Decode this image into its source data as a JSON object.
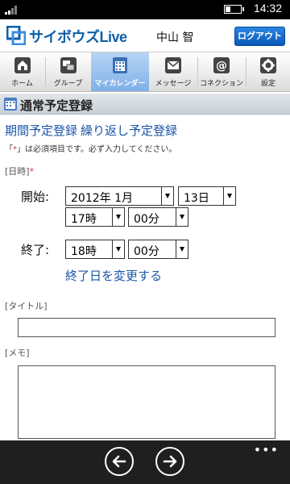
{
  "status_bar": {
    "time": "14:32",
    "battery_icon": "battery-icon",
    "signal_icon": "signal-icon"
  },
  "header": {
    "app_name": "サイボウズLive",
    "user_name": "中山 智",
    "logout_label": "ログアウト"
  },
  "nav": {
    "items": [
      {
        "label": "ホーム",
        "icon": "home-icon",
        "active": false
      },
      {
        "label": "グループ",
        "icon": "group-icon",
        "active": false
      },
      {
        "label": "マイカレンダー",
        "icon": "calendar-icon",
        "active": true
      },
      {
        "label": "メッセージ",
        "icon": "mail-icon",
        "active": false
      },
      {
        "label": "コネクション",
        "icon": "at-icon",
        "active": false
      },
      {
        "label": "設定",
        "icon": "gear-icon",
        "active": false
      }
    ]
  },
  "section": {
    "title": "通常予定登録"
  },
  "links": {
    "period": "期間予定登録",
    "repeat": "繰り返し予定登録"
  },
  "notice": {
    "prefix": "「",
    "star": "*",
    "text": "」は必須項目です。必ず入力してください。"
  },
  "datetime": {
    "label": "[日時]",
    "required_mark": "*",
    "start_label": "開始:",
    "start_month": "2012年 1月",
    "start_day": "13日",
    "start_hour": "17時",
    "start_minute": "00分",
    "end_label": "終了:",
    "end_hour": "18時",
    "end_minute": "00分",
    "change_end_date": "終了日を変更する"
  },
  "title_field": {
    "label": "[タイトル]",
    "value": ""
  },
  "memo_field": {
    "label": "[メモ]",
    "value": ""
  },
  "app_bar": {
    "more": "•••",
    "back_icon": "back-arrow-icon",
    "forward_icon": "forward-arrow-icon"
  }
}
